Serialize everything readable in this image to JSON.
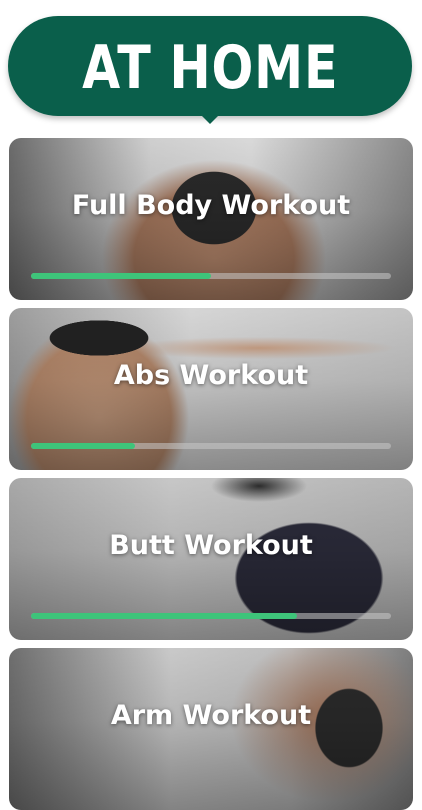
{
  "header": {
    "title": "AT HOME"
  },
  "workouts": [
    {
      "title": "Full Body Workout",
      "progress": 0.5
    },
    {
      "title": "Abs Workout",
      "progress": 0.29
    },
    {
      "title": "Butt Workout",
      "progress": 0.74
    },
    {
      "title": "Arm Workout",
      "progress": null
    }
  ],
  "colors": {
    "header_bg": "#0a5f4b",
    "progress_fill": "#3ec47a",
    "progress_track": "#c8c8c8"
  }
}
